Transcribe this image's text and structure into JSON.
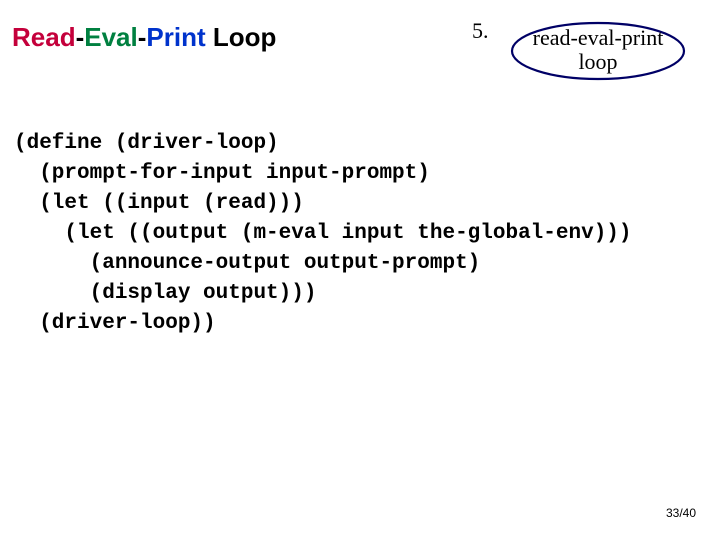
{
  "header": {
    "title_parts": {
      "read": "Read",
      "dash1": "-",
      "eval": "Eval",
      "dash2": "-",
      "print": "Print",
      "space": " ",
      "loop": "Loop"
    },
    "step_number": "5.",
    "oval_line1": "read-eval-print",
    "oval_line2": "loop"
  },
  "code_lines": [
    "(define (driver-loop)",
    "  (prompt-for-input input-prompt)",
    "  (let ((input (read)))",
    "    (let ((output (m-eval input the-global-env)))",
    "      (announce-output output-prompt)",
    "      (display output)))",
    "  (driver-loop))"
  ],
  "footer": {
    "page": "33/40"
  }
}
